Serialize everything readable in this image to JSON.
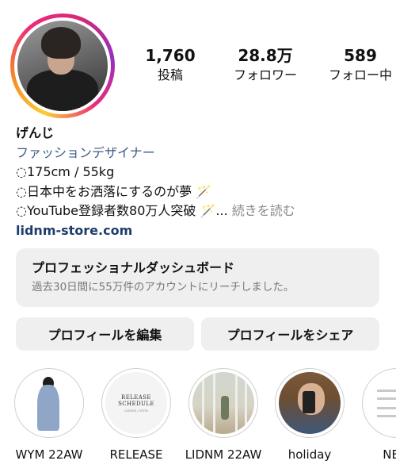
{
  "profile": {
    "stats": [
      {
        "value": "1,760",
        "label": "投稿"
      },
      {
        "value": "28.8万",
        "label": "フォロワー"
      },
      {
        "value": "589",
        "label": "フォロー中"
      }
    ],
    "name": "げんじ",
    "category": "ファッションデザイナー",
    "bio_lines": [
      "◌175cm / 55kg",
      "◌日本中をお洒落にするのが夢 🪄",
      "◌YouTube登録者数80万人突破 🪄..."
    ],
    "more_label": "続きを読む",
    "link": "lidnm-store.com"
  },
  "dashboard": {
    "title": "プロフェッショナルダッシュボード",
    "subtitle": "過去30日間に55万件のアカウントにリーチしました。"
  },
  "buttons": {
    "edit_label": "プロフィールを編集",
    "share_label": "プロフィールをシェア"
  },
  "highlights": [
    {
      "label": "WYM 22AW"
    },
    {
      "label": "RELEASE",
      "cover_title": "RELEASE SCHEDULE",
      "cover_sub": "LIDNM / WYM"
    },
    {
      "label": "LIDNM 22AW"
    },
    {
      "label": "holiday"
    },
    {
      "label": "NEW"
    }
  ]
}
